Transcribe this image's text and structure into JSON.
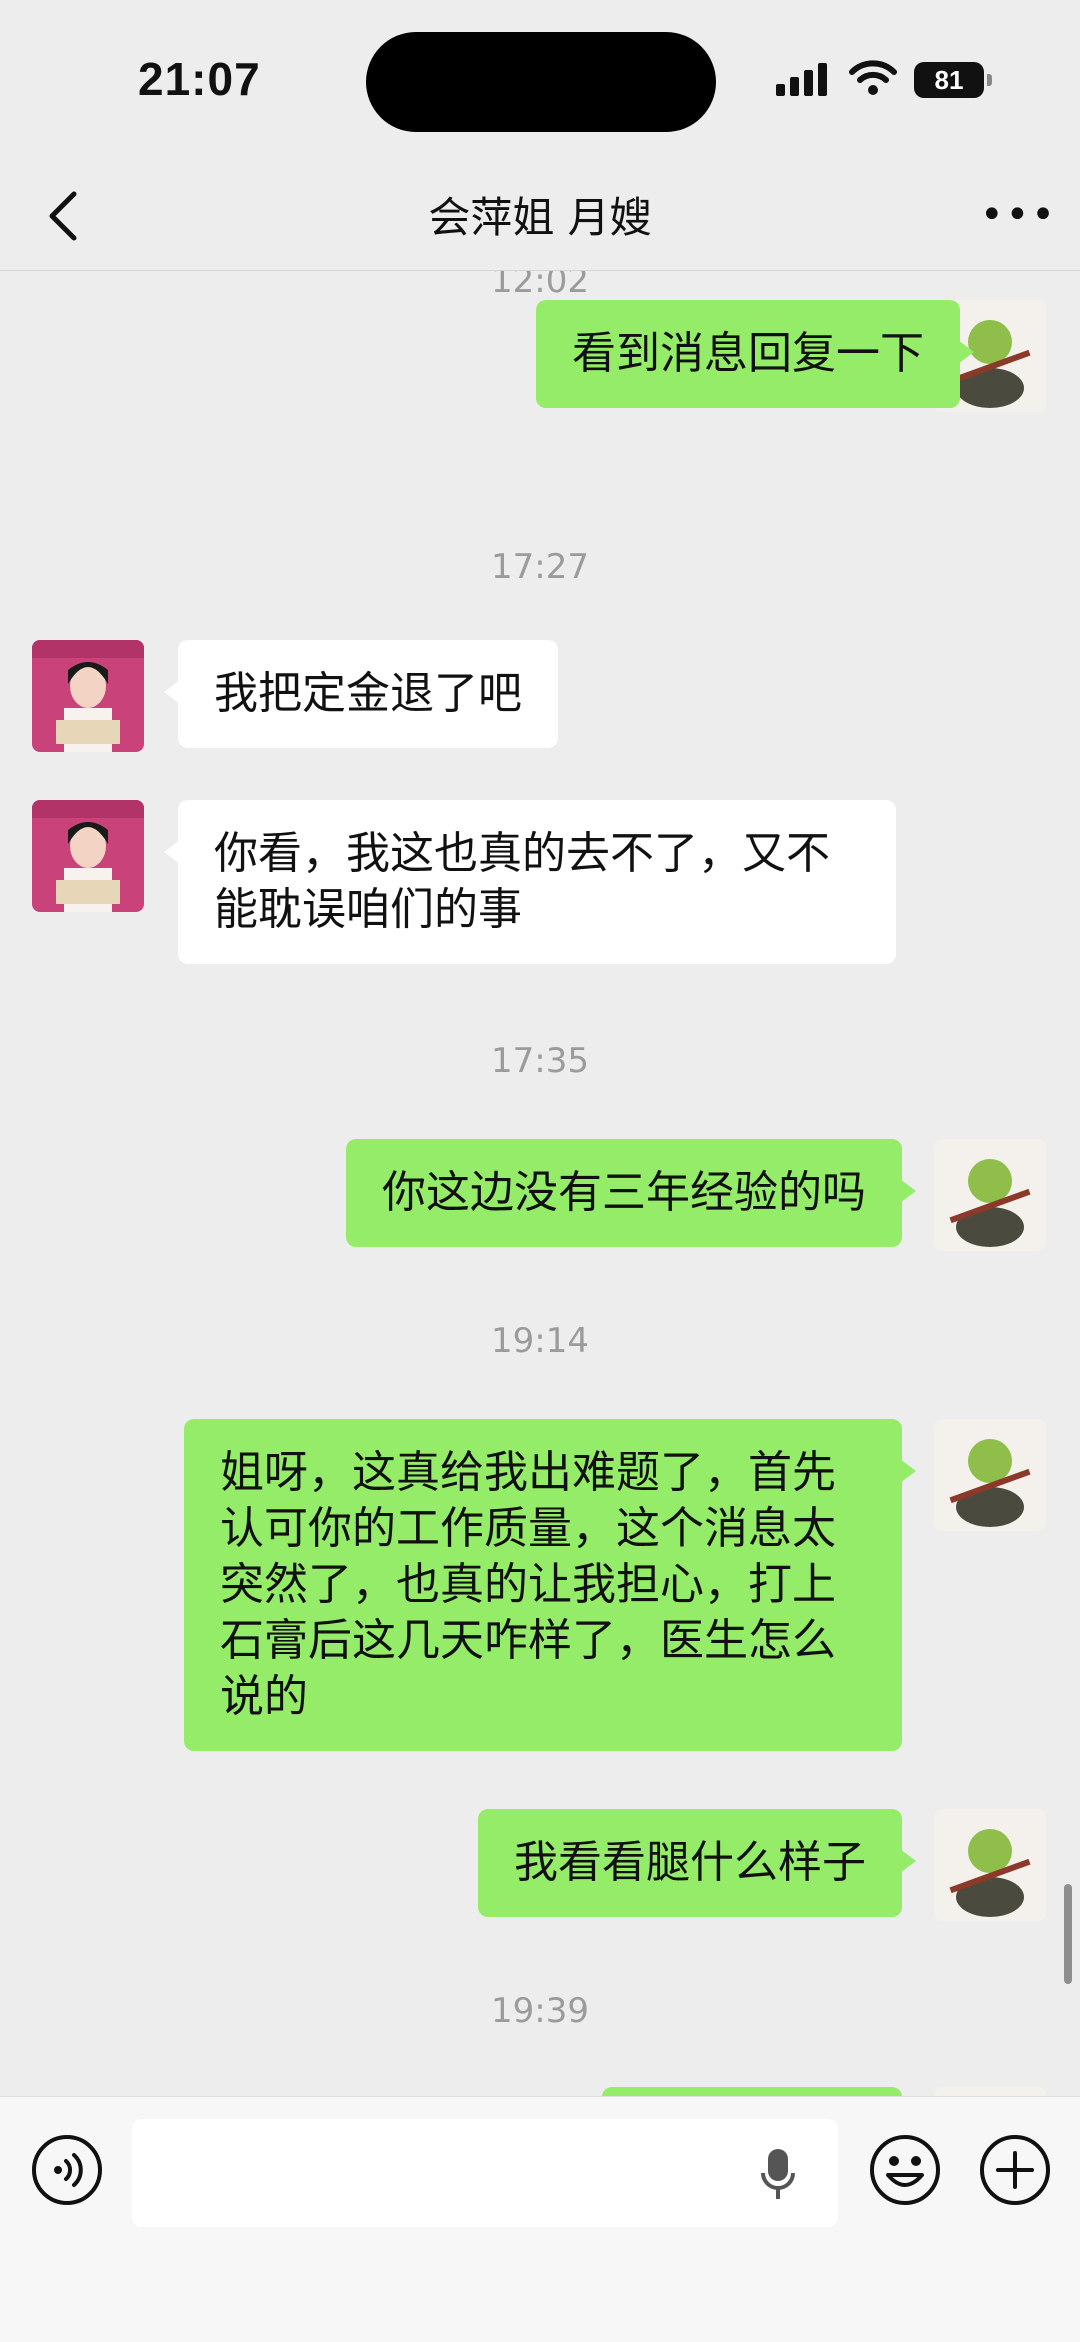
{
  "status_bar": {
    "time": "21:07",
    "battery": "81"
  },
  "header": {
    "title": "会萍姐 月嫂"
  },
  "chat": {
    "timestamps": [
      "12:02",
      "17:27",
      "17:35",
      "19:14",
      "19:39"
    ],
    "messages": [
      {
        "sender": "me",
        "text": "看到消息回复一下"
      },
      {
        "sender": "contact",
        "text": "我把定金退了吧"
      },
      {
        "sender": "contact",
        "text": "你看，我这也真的去不了，又不能耽误咱们的事"
      },
      {
        "sender": "me",
        "text": "你这边没有三年经验的吗"
      },
      {
        "sender": "me",
        "text": "姐呀，这真给我出难题了，首先认可你的工作质量，这个消息太突然了，也真的让我担心，打上石膏后这几天咋样了，医生怎么说的"
      },
      {
        "sender": "me",
        "text": "我看看腿什么样子"
      }
    ]
  },
  "input": {
    "value": ""
  },
  "colors": {
    "outgoing_bubble": "#95ec69",
    "incoming_bubble": "#ffffff",
    "background": "#ededed"
  }
}
